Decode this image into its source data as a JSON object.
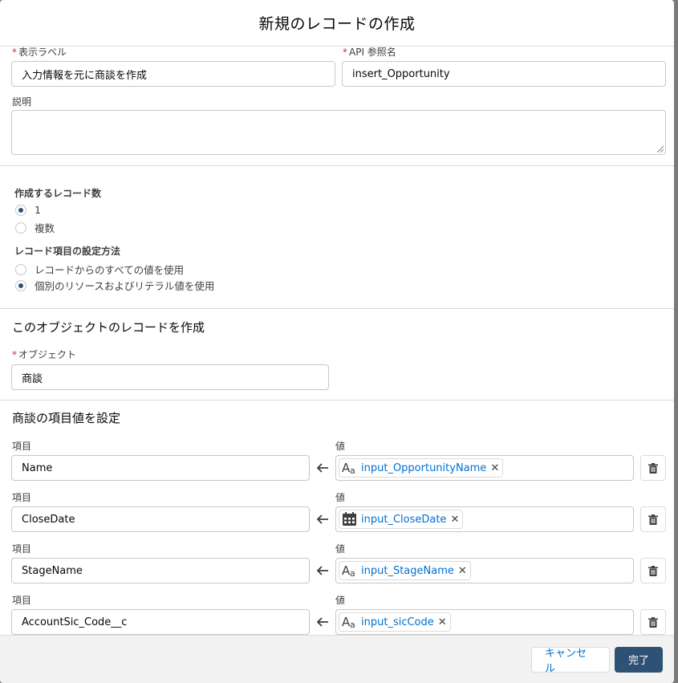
{
  "modal": {
    "title": "新規のレコードの作成"
  },
  "general": {
    "label_field": {
      "label": "表示ラベル",
      "value": "入力情報を元に商談を作成"
    },
    "api_field": {
      "label": "API 参照名",
      "value": "insert_Opportunity"
    },
    "description": {
      "label": "説明",
      "value": ""
    }
  },
  "record_count": {
    "label": "作成するレコード数",
    "options": [
      {
        "label": "1",
        "checked": true
      },
      {
        "label": "複数",
        "checked": false
      }
    ]
  },
  "field_method": {
    "label": "レコード項目の設定方法",
    "options": [
      {
        "label": "レコードからのすべての値を使用",
        "checked": false
      },
      {
        "label": "個別のリソースおよびリテラル値を使用",
        "checked": true
      }
    ]
  },
  "object_section": {
    "title": "このオブジェクトのレコードを作成",
    "object_label": "オブジェクト",
    "object_value": "商談"
  },
  "field_values": {
    "title": "商談の項目値を設定",
    "field_label": "項目",
    "value_label": "値",
    "rows": [
      {
        "field": "Name",
        "value": "input_OpportunityName",
        "icon": "text-icon"
      },
      {
        "field": "CloseDate",
        "value": "input_CloseDate",
        "icon": "calendar-icon"
      },
      {
        "field": "StageName",
        "value": "input_StageName",
        "icon": "text-icon"
      },
      {
        "field": "AccountSic_Code__c",
        "value": "input_sicCode",
        "icon": "text-icon"
      }
    ]
  },
  "footer": {
    "cancel": "キャンセル",
    "done": "完了"
  },
  "colors": {
    "brand": "#2e5275",
    "link": "#0070d2",
    "required": "#c23934"
  }
}
